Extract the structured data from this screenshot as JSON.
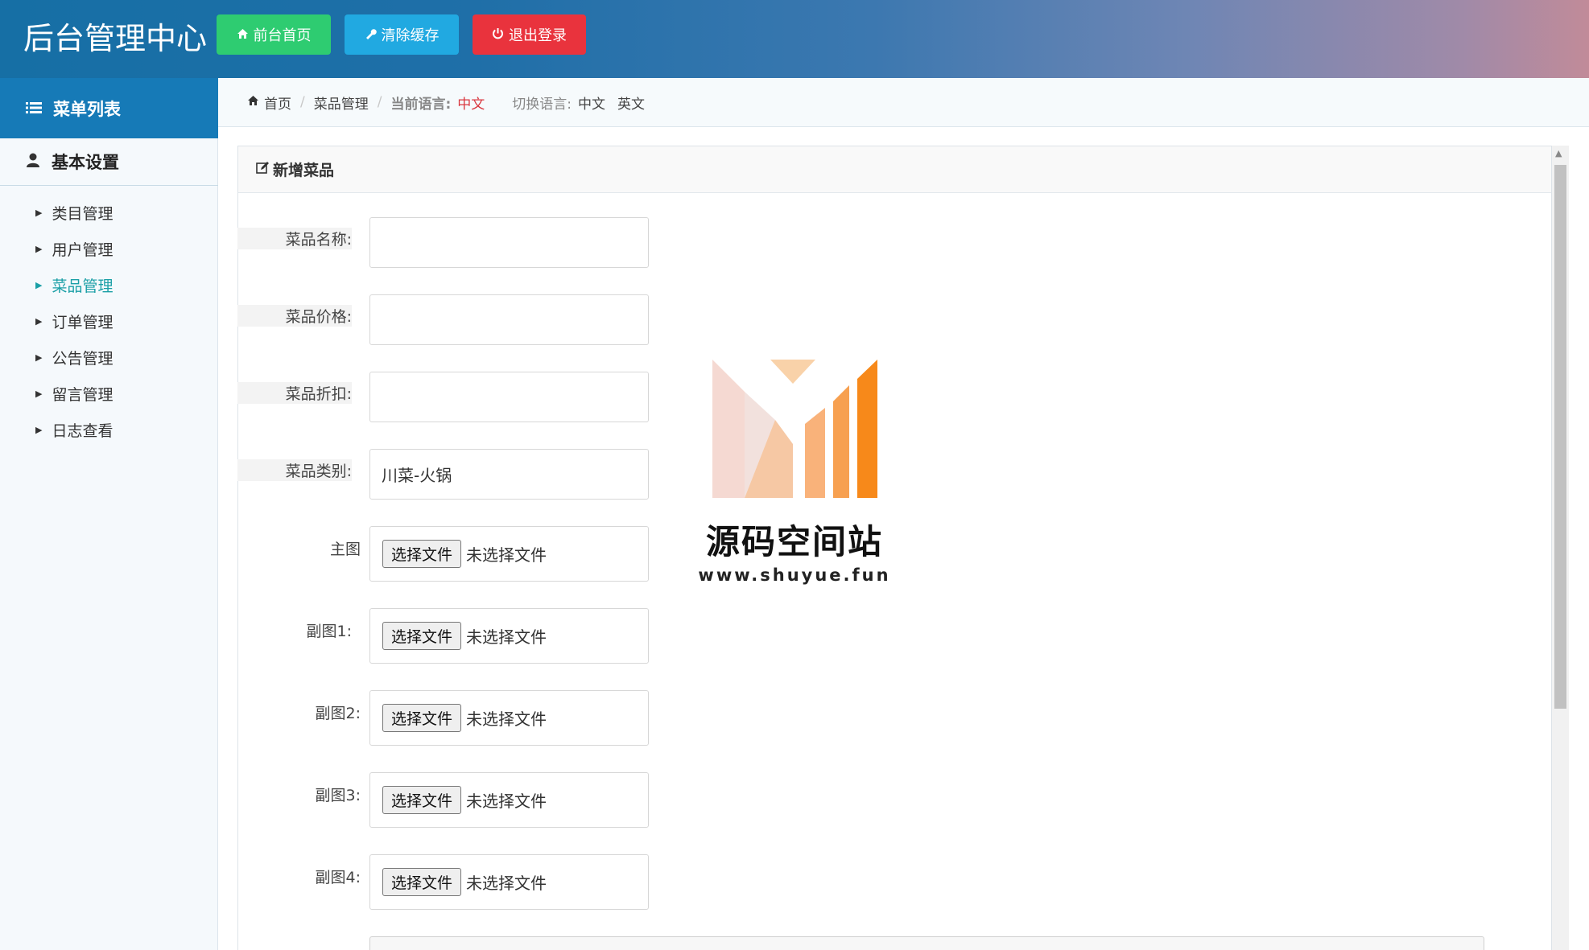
{
  "header": {
    "brand": "后台管理中心",
    "buttons": {
      "home": "前台首页",
      "clear_cache": "清除缓存",
      "logout": "退出登录"
    }
  },
  "sidebar": {
    "title": "菜单列表",
    "group": "基本设置",
    "items": [
      {
        "label": "类目管理",
        "active": false
      },
      {
        "label": "用户管理",
        "active": false
      },
      {
        "label": "菜品管理",
        "active": true
      },
      {
        "label": "订单管理",
        "active": false
      },
      {
        "label": "公告管理",
        "active": false
      },
      {
        "label": "留言管理",
        "active": false
      },
      {
        "label": "日志查看",
        "active": false
      }
    ]
  },
  "breadcrumb": {
    "home": "首页",
    "section": "菜品管理",
    "current_lang_label": "当前语言:",
    "current_lang": "中文",
    "switch_label": "切换语言:",
    "lang_zh": "中文",
    "lang_en": "英文"
  },
  "panel": {
    "title": "新增菜品"
  },
  "form": {
    "name_label": "菜品名称:",
    "name_value": "",
    "price_label": "菜品价格:",
    "price_value": "",
    "discount_label": "菜品折扣:",
    "discount_value": "",
    "category_label": "菜品类别:",
    "category_value": "川菜-火锅",
    "main_image_label": "主图",
    "sub1_label": "副图1:",
    "sub2_label": "副图2:",
    "sub3_label": "副图3:",
    "sub4_label": "副图4:",
    "file_button": "选择文件",
    "no_file": "未选择文件"
  },
  "watermark": {
    "title": "源码空间站",
    "url": "www.shuyue.fun"
  },
  "colors": {
    "primary": "#167ab7",
    "success": "#2ecc71",
    "info": "#21a9e1",
    "danger": "#e9333d",
    "active_link": "#1a9fa6",
    "accent_orange": "#f7891a"
  }
}
